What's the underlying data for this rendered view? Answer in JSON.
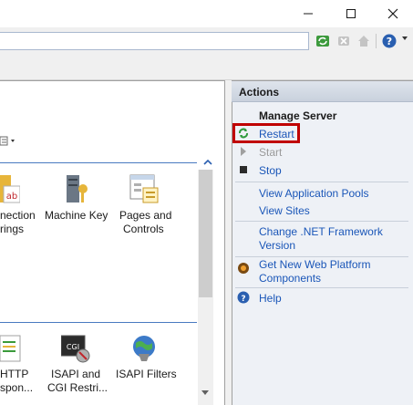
{
  "window": {
    "controls": {
      "minimize": "minimize",
      "maximize": "maximize",
      "close": "close"
    }
  },
  "toolbar": {
    "address_value": "",
    "icons": [
      "refresh-icon",
      "stop-icon",
      "home-icon",
      "help-icon"
    ]
  },
  "features": {
    "group1": [
      {
        "icon": "connection-strings-icon",
        "label_line1": "nection",
        "label_line2": "rings"
      },
      {
        "icon": "machine-key-icon",
        "label_line1": "Machine Key",
        "label_line2": ""
      },
      {
        "icon": "pages-controls-icon",
        "label_line1": "Pages and",
        "label_line2": "Controls"
      }
    ],
    "group2": [
      {
        "icon": "http-response-icon",
        "label_line1": "HTTP",
        "label_line2": "spon..."
      },
      {
        "icon": "isapi-cgi-icon",
        "label_line1": "ISAPI and",
        "label_line2": "CGI Restri..."
      },
      {
        "icon": "isapi-filters-icon",
        "label_line1": "ISAPI Filters",
        "label_line2": ""
      }
    ]
  },
  "actions": {
    "title": "Actions",
    "section_title": "Manage Server",
    "restart": "Restart",
    "start": "Start",
    "stop": "Stop",
    "view_app_pools": "View Application Pools",
    "view_sites": "View Sites",
    "change_net_line1": "Change .NET Framework",
    "change_net_line2": "Version",
    "get_web_line1": "Get New Web Platform",
    "get_web_line2": "Components",
    "help": "Help"
  },
  "colors": {
    "link": "#1a56b8",
    "disabled": "#9a9a9a",
    "highlight_border": "#c00000",
    "group_line": "#4a7ac0"
  }
}
